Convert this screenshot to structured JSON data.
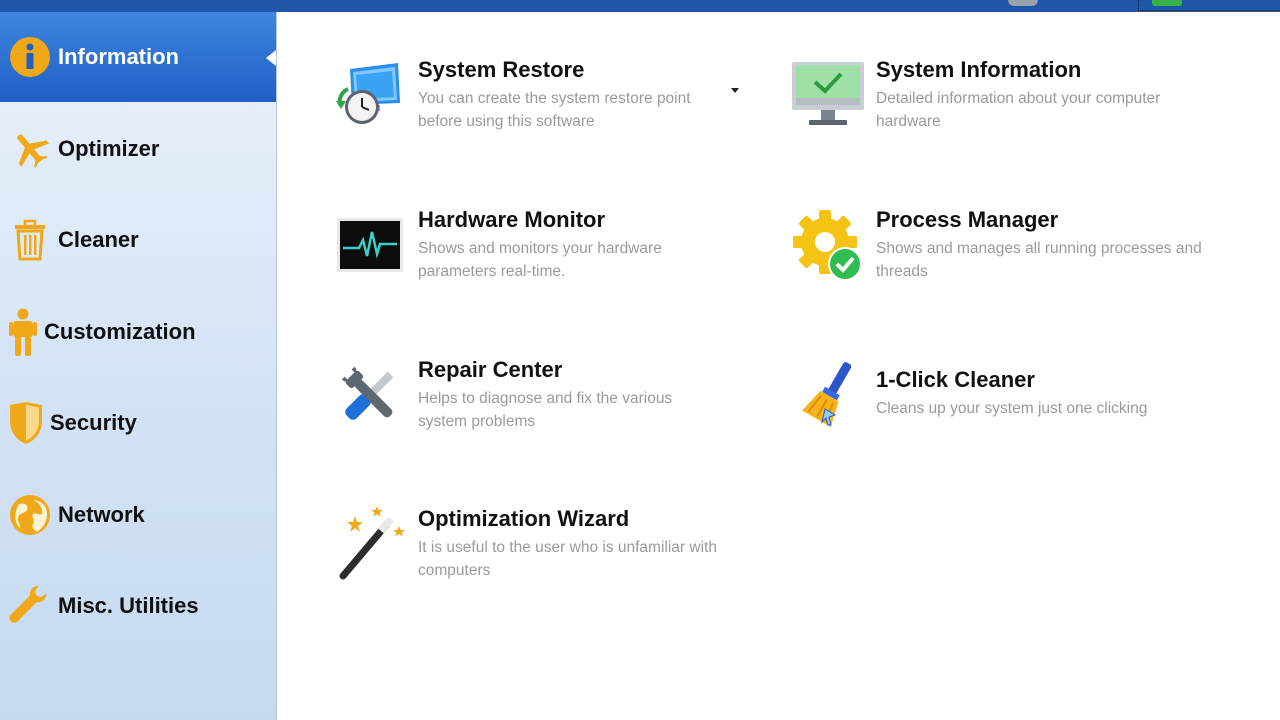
{
  "sidebar": {
    "items": [
      {
        "label": "Information",
        "icon": "info-icon",
        "active": true
      },
      {
        "label": "Optimizer",
        "icon": "airplane-icon"
      },
      {
        "label": "Cleaner",
        "icon": "trash-icon"
      },
      {
        "label": "Customization",
        "icon": "person-icon"
      },
      {
        "label": "Security",
        "icon": "shield-icon"
      },
      {
        "label": "Network",
        "icon": "globe-icon"
      },
      {
        "label": "Misc. Utilities",
        "icon": "wrench-icon"
      }
    ]
  },
  "tiles": [
    {
      "title": "System Restore",
      "desc": "You can create the system restore point before using this software",
      "icon": "system-restore-icon"
    },
    {
      "title": "System Information",
      "desc": "Detailed information about your computer hardware",
      "icon": "monitor-check-icon"
    },
    {
      "title": "Hardware Monitor",
      "desc": "Shows and monitors your hardware parameters real-time.",
      "icon": "pulse-monitor-icon"
    },
    {
      "title": "Process Manager",
      "desc": "Shows and manages all running processes and threads",
      "icon": "gear-check-icon"
    },
    {
      "title": "Repair Center",
      "desc": "Helps to diagnose and fix the various system problems",
      "icon": "wrench-screwdriver-icon"
    },
    {
      "title": "1-Click Cleaner",
      "desc": "Cleans up your system just one clicking",
      "icon": "broom-icon"
    },
    {
      "title": "Optimization Wizard",
      "desc": "It is useful to the user who is unfamiliar with computers",
      "icon": "magic-wand-icon"
    }
  ],
  "colors": {
    "accent": "#1e5fc4",
    "icon_orange": "#f0a818",
    "desc_gray": "#9a9a9a"
  }
}
